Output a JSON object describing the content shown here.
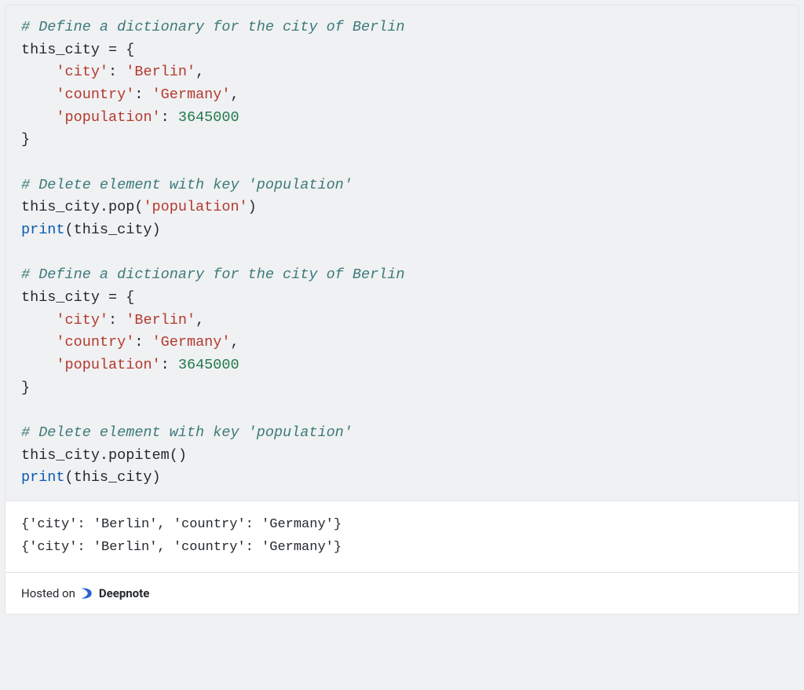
{
  "code": {
    "lines": [
      [
        {
          "cls": "c",
          "t": "# Define a dictionary for the city of Berlin"
        }
      ],
      [
        {
          "cls": "p",
          "t": "this_city = {"
        }
      ],
      [
        {
          "cls": "p",
          "t": "    "
        },
        {
          "cls": "s",
          "t": "'city'"
        },
        {
          "cls": "p",
          "t": ": "
        },
        {
          "cls": "s",
          "t": "'Berlin'"
        },
        {
          "cls": "p",
          "t": ","
        }
      ],
      [
        {
          "cls": "p",
          "t": "    "
        },
        {
          "cls": "s",
          "t": "'country'"
        },
        {
          "cls": "p",
          "t": ": "
        },
        {
          "cls": "s",
          "t": "'Germany'"
        },
        {
          "cls": "p",
          "t": ","
        }
      ],
      [
        {
          "cls": "p",
          "t": "    "
        },
        {
          "cls": "s",
          "t": "'population'"
        },
        {
          "cls": "p",
          "t": ": "
        },
        {
          "cls": "n",
          "t": "3645000"
        }
      ],
      [
        {
          "cls": "p",
          "t": "}"
        }
      ],
      [
        {
          "cls": "p",
          "t": ""
        }
      ],
      [
        {
          "cls": "c",
          "t": "# Delete element with key 'population'"
        }
      ],
      [
        {
          "cls": "p",
          "t": "this_city.pop("
        },
        {
          "cls": "s",
          "t": "'population'"
        },
        {
          "cls": "p",
          "t": ")"
        }
      ],
      [
        {
          "cls": "k",
          "t": "print"
        },
        {
          "cls": "p",
          "t": "(this_city)"
        }
      ],
      [
        {
          "cls": "p",
          "t": ""
        }
      ],
      [
        {
          "cls": "c",
          "t": "# Define a dictionary for the city of Berlin"
        }
      ],
      [
        {
          "cls": "p",
          "t": "this_city = {"
        }
      ],
      [
        {
          "cls": "p",
          "t": "    "
        },
        {
          "cls": "s",
          "t": "'city'"
        },
        {
          "cls": "p",
          "t": ": "
        },
        {
          "cls": "s",
          "t": "'Berlin'"
        },
        {
          "cls": "p",
          "t": ","
        }
      ],
      [
        {
          "cls": "p",
          "t": "    "
        },
        {
          "cls": "s",
          "t": "'country'"
        },
        {
          "cls": "p",
          "t": ": "
        },
        {
          "cls": "s",
          "t": "'Germany'"
        },
        {
          "cls": "p",
          "t": ","
        }
      ],
      [
        {
          "cls": "p",
          "t": "    "
        },
        {
          "cls": "s",
          "t": "'population'"
        },
        {
          "cls": "p",
          "t": ": "
        },
        {
          "cls": "n",
          "t": "3645000"
        }
      ],
      [
        {
          "cls": "p",
          "t": "}"
        }
      ],
      [
        {
          "cls": "p",
          "t": ""
        }
      ],
      [
        {
          "cls": "c",
          "t": "# Delete element with key 'population'"
        }
      ],
      [
        {
          "cls": "p",
          "t": "this_city.popitem()"
        }
      ],
      [
        {
          "cls": "k",
          "t": "print"
        },
        {
          "cls": "p",
          "t": "(this_city)"
        }
      ]
    ]
  },
  "output": {
    "lines": [
      "{'city': 'Berlin', 'country': 'Germany'}",
      "{'city': 'Berlin', 'country': 'Germany'}"
    ]
  },
  "footer": {
    "prefix": "Hosted on ",
    "brand": "Deepnote"
  }
}
